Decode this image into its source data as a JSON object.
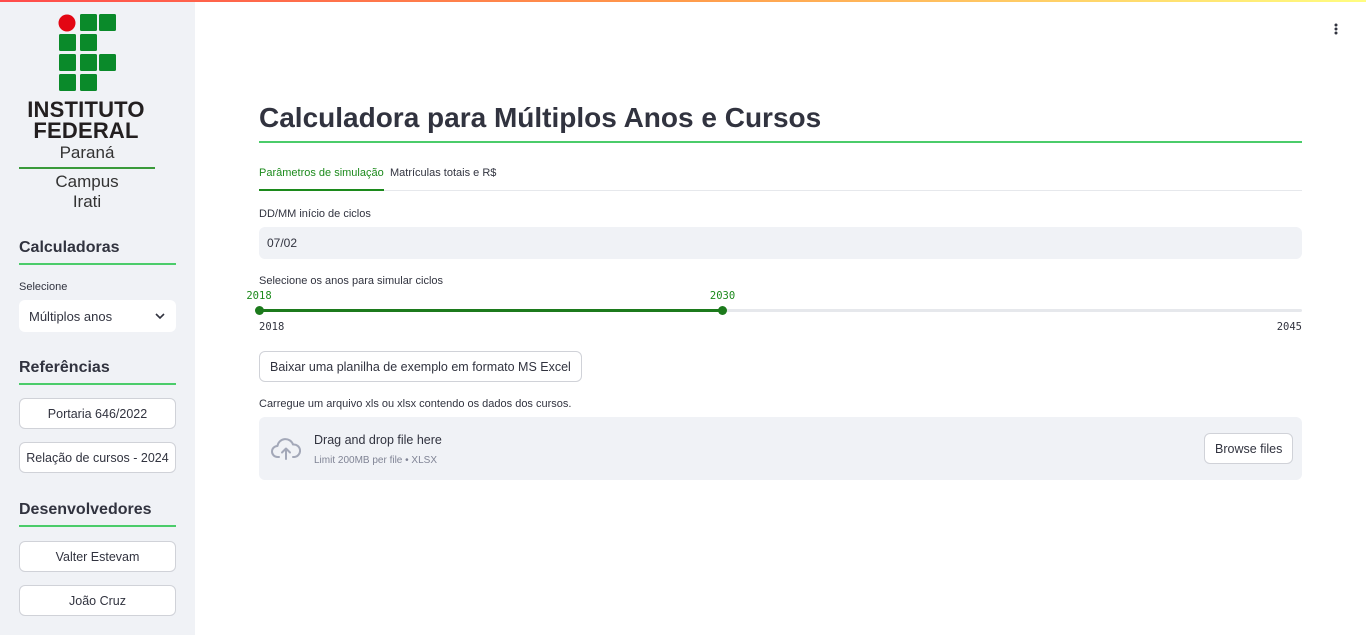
{
  "logo": {
    "line1": "INSTITUTO",
    "line2": "FEDERAL",
    "state": "Paraná",
    "campus_line1": "Campus",
    "campus_line2": "Irati",
    "colors": {
      "green": "#0a8a2a",
      "red": "#e30613"
    }
  },
  "sidebar": {
    "calc_heading": "Calculadoras",
    "select_label": "Selecione",
    "select_value": "Múltiplos anos",
    "refs_heading": "Referências",
    "refs": [
      "Portaria 646/2022",
      "Relação de cursos - 2024"
    ],
    "devs_heading": "Desenvolvedores",
    "devs": [
      "Valter Estevam",
      "João Cruz"
    ]
  },
  "main": {
    "title": "Calculadora para Múltiplos Anos e Cursos",
    "tabs": [
      {
        "label": "Parâmetros de simulação",
        "active": true
      },
      {
        "label": "Matrículas totais e R$",
        "active": false
      }
    ],
    "date_label": "DD/MM início de ciclos",
    "date_value": "07/02",
    "slider_label": "Selecione os anos para simular ciclos",
    "slider": {
      "min": 2018,
      "max": 2045,
      "low": 2018,
      "high": 2030
    },
    "download_label": "Baixar uma planilha de exemplo em formato MS Excel",
    "upload_label": "Carregue um arquivo xls ou xlsx contendo os dados dos cursos.",
    "dropzone_title": "Drag and drop file here",
    "dropzone_limit": "Limit 200MB per file • XLSX",
    "browse_label": "Browse files"
  },
  "colors": {
    "accent": "#1c8a1c",
    "divider": "#4bcc6a",
    "sidebar_bg": "#f0f2f6"
  }
}
